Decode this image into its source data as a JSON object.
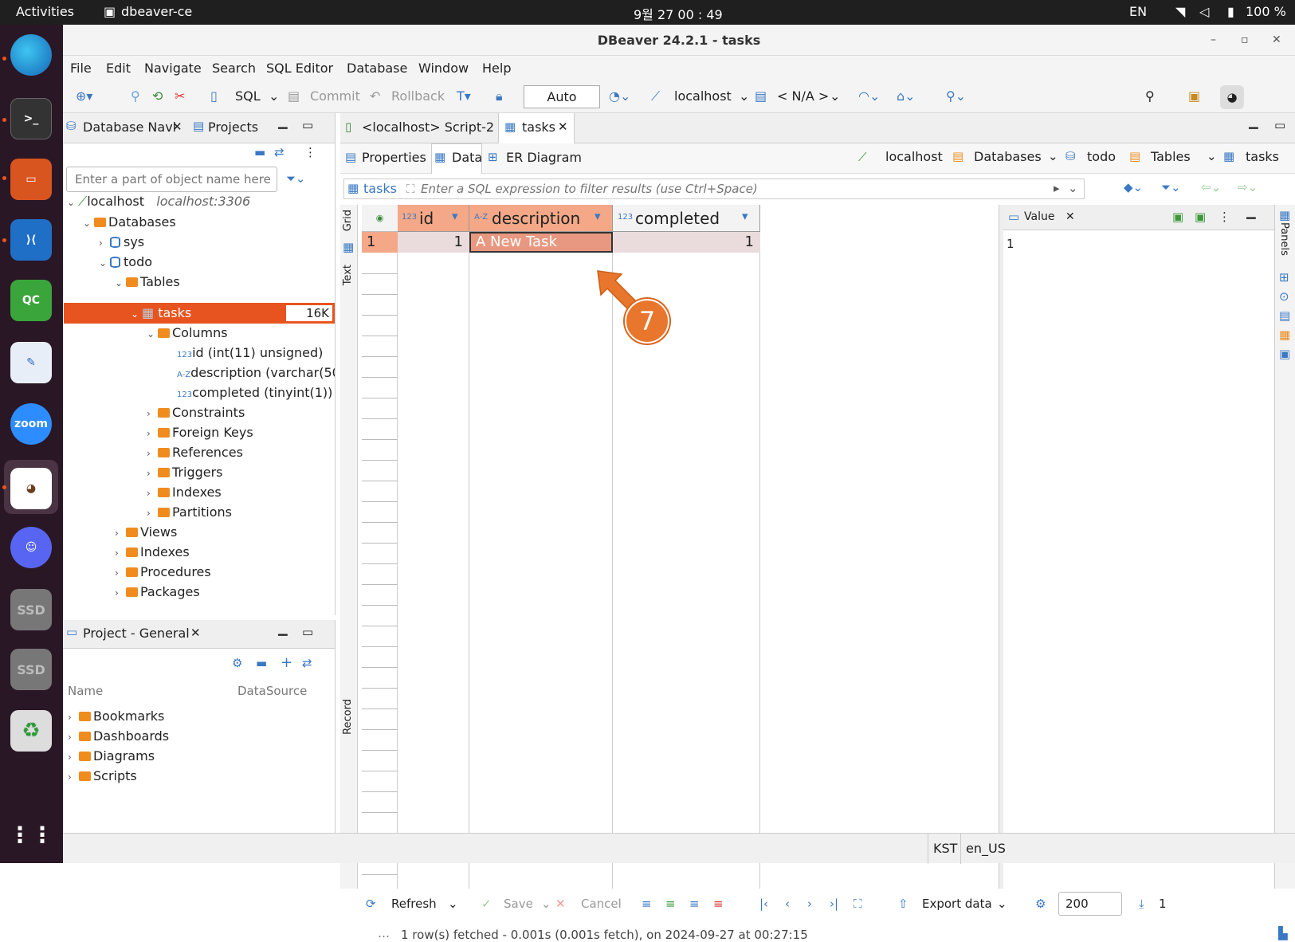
{
  "system_bar": {
    "activities": "Activities",
    "app": "dbeaver-ce",
    "clock": "9월 27  00 : 49",
    "lang": "EN",
    "battery": "100 %"
  },
  "window": {
    "title": "DBeaver 24.2.1 - tasks",
    "minimize": "–",
    "maximize": "▫",
    "close": "✕"
  },
  "menu": [
    "File",
    "Edit",
    "Navigate",
    "Search",
    "SQL Editor",
    "Database",
    "Window",
    "Help"
  ],
  "toolbar": {
    "sql": "SQL",
    "commit": "Commit",
    "rollback": "Rollback",
    "mode": "Auto",
    "connection": "localhost",
    "schema": "< N/A >"
  },
  "nav": {
    "tab1": "Database Navi",
    "tab2": "Projects",
    "filter_placeholder": "Enter a part of object name here",
    "connection": "localhost",
    "connection_addr": "localhost:3306",
    "databases": "Databases",
    "db_sys": "sys",
    "db_todo": "todo",
    "tables": "Tables",
    "table": "tasks",
    "table_size": "16K",
    "columns": "Columns",
    "col1": "id (int(11) unsigned)",
    "col2": "description (varchar(50",
    "col3": "completed (tinyint(1))",
    "constraints": "Constraints",
    "foreign_keys": "Foreign Keys",
    "references": "References",
    "triggers": "Triggers",
    "indexes": "Indexes",
    "partitions": "Partitions",
    "views": "Views",
    "indexes2": "Indexes",
    "procedures": "Procedures",
    "packages": "Packages"
  },
  "project": {
    "tab": "Project - General",
    "col_name": "Name",
    "col_datasource": "DataSource",
    "items": [
      "Bookmarks",
      "Dashboards",
      "Diagrams",
      "Scripts"
    ]
  },
  "editor": {
    "tab1": "<localhost> Script-2",
    "tab2": "tasks",
    "subtabs": [
      "Properties",
      "Data",
      "ER Diagram"
    ],
    "breadcrumb": [
      "localhost",
      "Databases",
      "todo",
      "Tables",
      "tasks"
    ],
    "filter_label": "tasks",
    "filter_placeholder": "Enter a SQL expression to filter results (use Ctrl+Space)",
    "side_tabs": [
      "Grid",
      "Text",
      "Record"
    ],
    "columns": [
      {
        "type": "123",
        "name": "id"
      },
      {
        "type": "A-Z",
        "name": "description"
      },
      {
        "type": "123",
        "name": "completed"
      }
    ],
    "row": {
      "num": "1",
      "id": "1",
      "description": "A New Task",
      "completed": "1"
    },
    "value_panel": {
      "title": "Value",
      "content": "1"
    },
    "panels_label": "Panels",
    "bottom": {
      "refresh": "Refresh",
      "save": "Save",
      "cancel": "Cancel",
      "export": "Export data",
      "limit": "200",
      "count": "1"
    },
    "status": "1 row(s) fetched - 0.001s (0.001s fetch), on 2024-09-27 at 00:27:15"
  },
  "annotation": {
    "step": "7"
  },
  "statusbar": {
    "tz": "KST",
    "locale": "en_US"
  }
}
